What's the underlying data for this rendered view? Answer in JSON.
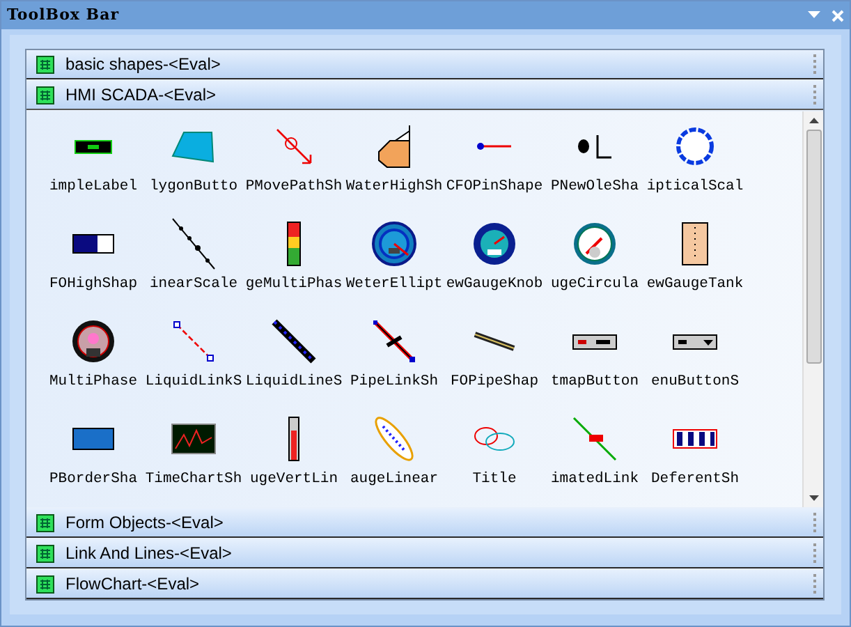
{
  "window": {
    "title": "ToolBox Bar"
  },
  "sections": [
    {
      "label": "basic shapes-<Eval>",
      "expanded": false
    },
    {
      "label": "HMI SCADA-<Eval>",
      "expanded": true,
      "items": [
        {
          "label": "impleLabel"
        },
        {
          "label": "lygonButto"
        },
        {
          "label": "PMovePathSh"
        },
        {
          "label": "WaterHighSh"
        },
        {
          "label": "CFOPinShape"
        },
        {
          "label": "PNewOleSha"
        },
        {
          "label": "ipticalScal"
        },
        {
          "label": "FOHighShap"
        },
        {
          "label": "inearScale"
        },
        {
          "label": "geMultiPhas"
        },
        {
          "label": "WeterEllipt"
        },
        {
          "label": "ewGaugeKnob"
        },
        {
          "label": "ugeCircula"
        },
        {
          "label": "ewGaugeTank"
        },
        {
          "label": "MultiPhase"
        },
        {
          "label": "LiquidLinkS"
        },
        {
          "label": "LiquidLineS"
        },
        {
          "label": "PipeLinkSh"
        },
        {
          "label": "FOPipeShap"
        },
        {
          "label": "tmapButton"
        },
        {
          "label": "enuButtonS"
        },
        {
          "label": "PBorderSha"
        },
        {
          "label": "TimeChartSh"
        },
        {
          "label": "ugeVertLin"
        },
        {
          "label": "augeLinear"
        },
        {
          "label": "Title"
        },
        {
          "label": "imatedLink"
        },
        {
          "label": "DeferentSh"
        }
      ]
    },
    {
      "label": "Form Objects-<Eval>",
      "expanded": false
    },
    {
      "label": "Link And Lines-<Eval>",
      "expanded": false
    },
    {
      "label": "FlowChart-<Eval>",
      "expanded": false
    }
  ]
}
